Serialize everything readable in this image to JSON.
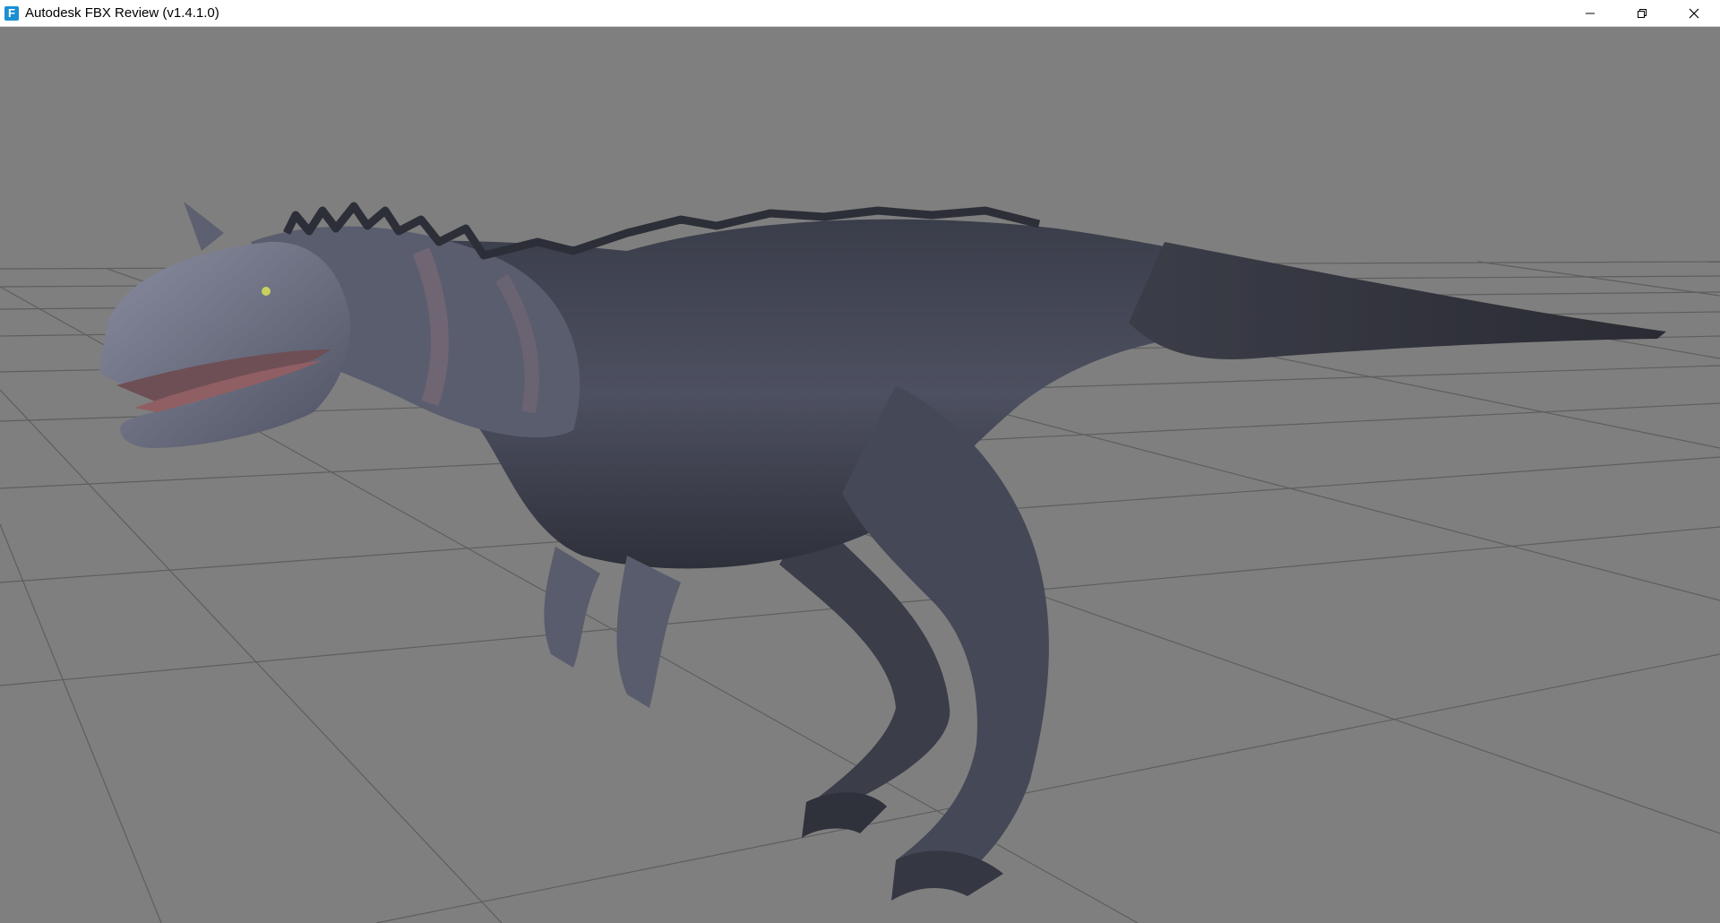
{
  "window": {
    "title": "Autodesk FBX Review (v1.4.1.0)",
    "app_icon": "fbx-review-icon",
    "app_icon_letter": "F",
    "controls": [
      "minimize-icon",
      "restore-icon",
      "close-icon"
    ]
  },
  "viewport": {
    "background_color": "#7f7f7f",
    "grid_color": "#5a5a5a",
    "model": "dinosaur-model"
  }
}
